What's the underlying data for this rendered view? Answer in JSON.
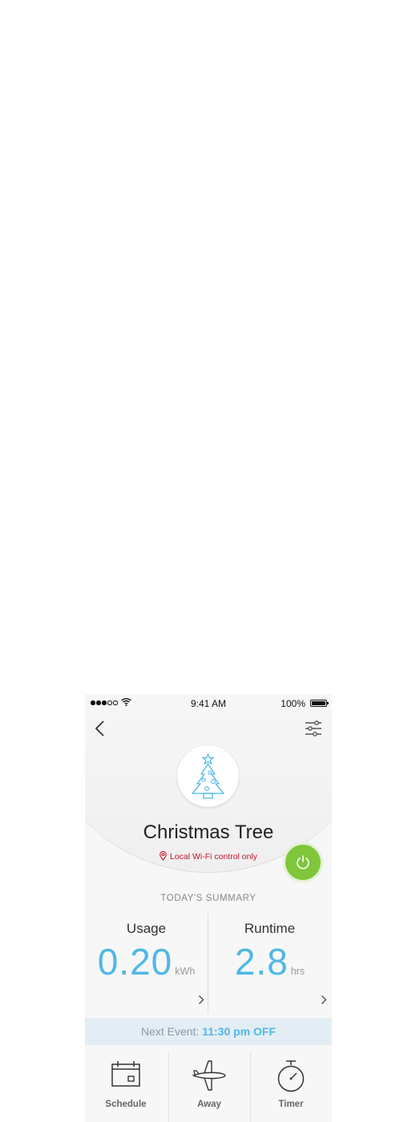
{
  "status_bar": {
    "time": "9:41 AM",
    "battery": "100%"
  },
  "device": {
    "name": "Christmas Tree",
    "connection_note": "Local Wi-Fi control only",
    "power_state": "on",
    "accent_color": "#7fc63b"
  },
  "summary": {
    "title": "TODAY'S SUMMARY",
    "usage": {
      "label": "Usage",
      "value": "0.20",
      "unit": "kWh"
    },
    "runtime": {
      "label": "Runtime",
      "value": "2.8",
      "unit": "hrs"
    }
  },
  "next_event": {
    "label": "Next Event:",
    "value": "11:30 pm OFF"
  },
  "tabs": [
    {
      "label": "Schedule",
      "icon": "calendar-icon"
    },
    {
      "label": "Away",
      "icon": "airplane-icon"
    },
    {
      "label": "Timer",
      "icon": "stopwatch-icon"
    }
  ],
  "colors": {
    "value_blue": "#4fb7e8",
    "warning_red": "#c2142d",
    "power_green": "#7fc63b"
  }
}
